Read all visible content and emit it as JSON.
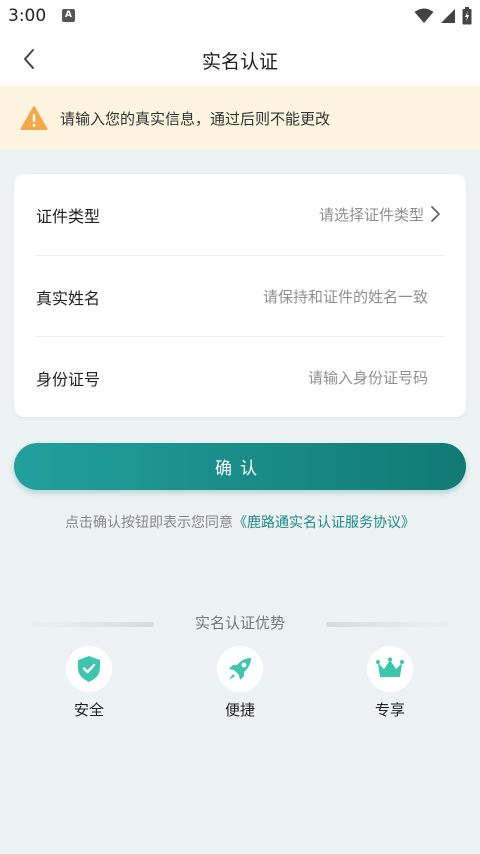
{
  "statusbar": {
    "time": "3:00",
    "notif_letter": "A"
  },
  "navbar": {
    "title": "实名认证"
  },
  "notice": {
    "text": "请输入您的真实信息，通过后则不能更改"
  },
  "form": {
    "rows": [
      {
        "label": "证件类型",
        "value": "请选择证件类型"
      },
      {
        "label": "真实姓名",
        "placeholder": "请保持和证件的姓名一致"
      },
      {
        "label": "身份证号",
        "placeholder": "请输入身份证号码"
      }
    ]
  },
  "confirm_label": "确认",
  "agreement": {
    "prefix": "点击确认按钮即表示您同意",
    "link": "《鹿路通实名认证服务协议》"
  },
  "advantages": {
    "title": "实名认证优势",
    "items": [
      {
        "label": "安全",
        "icon": "shield-check-icon"
      },
      {
        "label": "便捷",
        "icon": "rocket-icon"
      },
      {
        "label": "专享",
        "icon": "crown-icon"
      }
    ]
  },
  "colors": {
    "accent": "#1e8a86",
    "notice_bg": "#fdf4df",
    "warn": "#f2a94a"
  }
}
